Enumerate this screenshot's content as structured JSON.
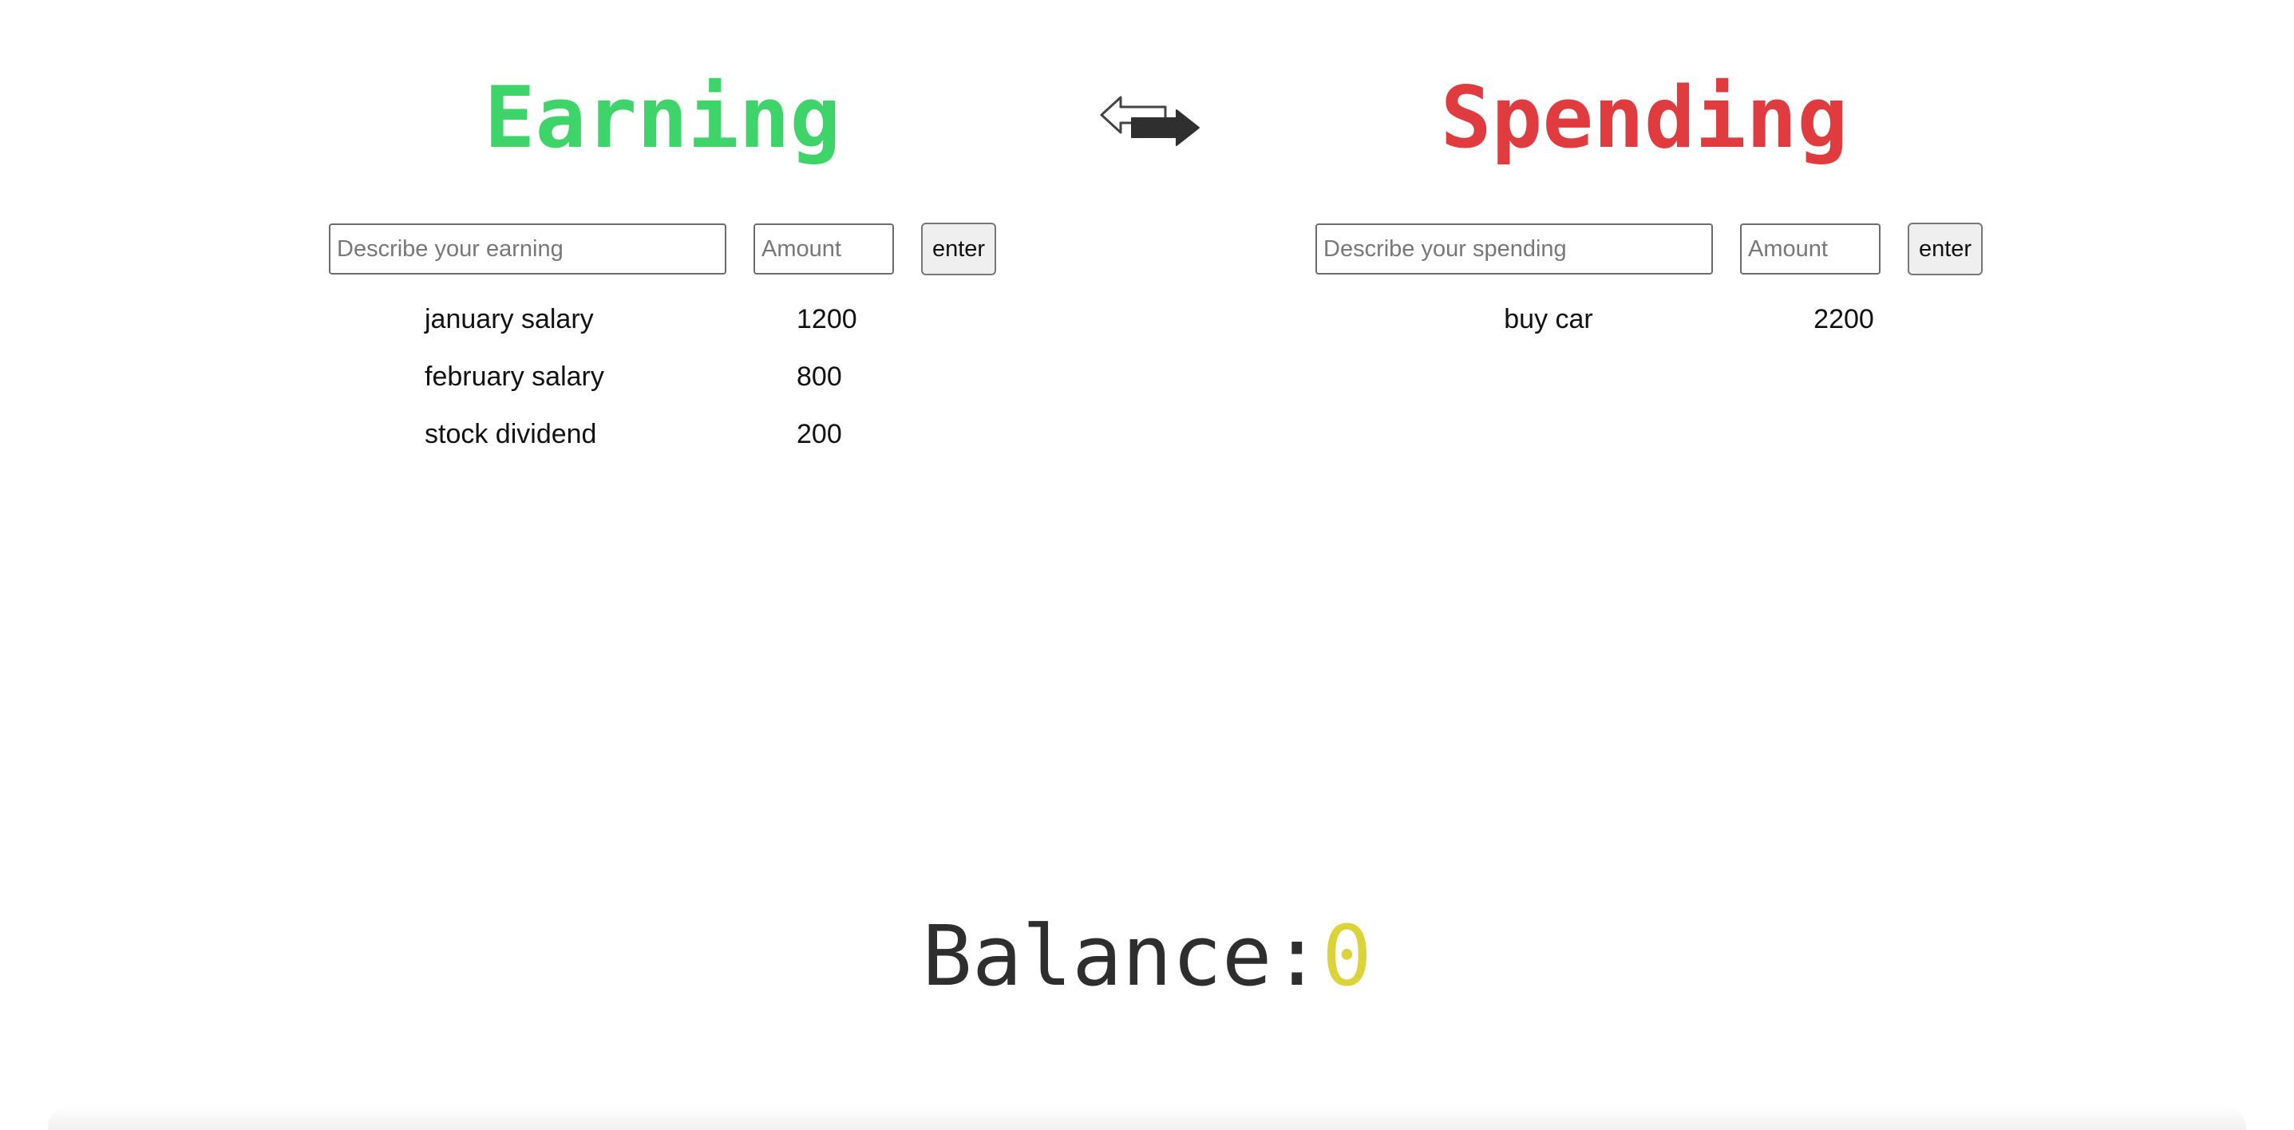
{
  "earning": {
    "title": "Earning",
    "title_color": "#3fd46a",
    "description_placeholder": "Describe your earning",
    "amount_placeholder": "Amount",
    "enter_label": "enter",
    "entries": [
      {
        "description": "january salary",
        "amount": "1200"
      },
      {
        "description": "february salary",
        "amount": "800"
      },
      {
        "description": "stock dividend",
        "amount": "200"
      }
    ]
  },
  "spending": {
    "title": "Spending",
    "title_color": "#e03b3f",
    "description_placeholder": "Describe your spending",
    "amount_placeholder": "Amount",
    "enter_label": "enter",
    "entries": [
      {
        "description": "buy car",
        "amount": "2200"
      }
    ]
  },
  "swap_icon": "exchange-arrows-icon",
  "balance": {
    "label": "Balance:",
    "value": "0",
    "value_color": "#dcd33a"
  }
}
